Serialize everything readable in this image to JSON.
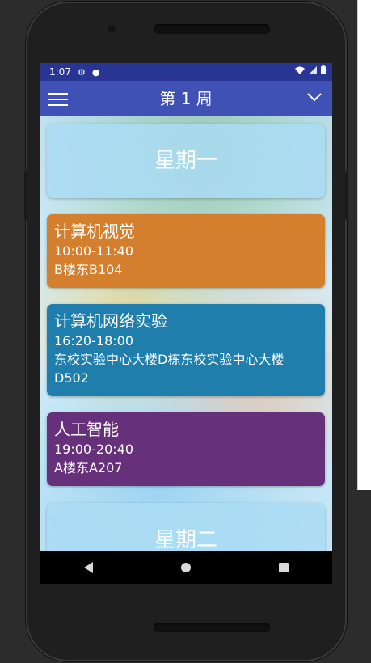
{
  "statusbar": {
    "time": "1:07",
    "icons": [
      "settings-icon",
      "dot-icon",
      "wifi-icon",
      "signal-icon",
      "battery-icon"
    ]
  },
  "appbar": {
    "title": "第 1 周",
    "menu_icon": "menu-icon",
    "dropdown_icon": "chevron-down-icon"
  },
  "schedule": {
    "days": [
      {
        "label": "星期一",
        "courses": [
          {
            "name": "计算机视觉",
            "time": "10:00-11:40",
            "room": "B楼东B104",
            "color": "#d47f2e"
          },
          {
            "name": "计算机网络实验",
            "time": "16:20-18:00",
            "room": "东校实验中心大楼D栋东校实验中心大楼D502",
            "color": "#1f7eab"
          },
          {
            "name": "人工智能",
            "time": "19:00-20:40",
            "room": "A楼东A207",
            "color": "#67307a"
          }
        ]
      },
      {
        "label": "星期二",
        "courses": []
      }
    ]
  },
  "navbar": {
    "icons": [
      "back-icon",
      "home-icon",
      "recents-icon"
    ]
  },
  "colors": {
    "statusbar": "#283593",
    "appbar": "#3f51b5",
    "day_card": "#aadcf5"
  }
}
